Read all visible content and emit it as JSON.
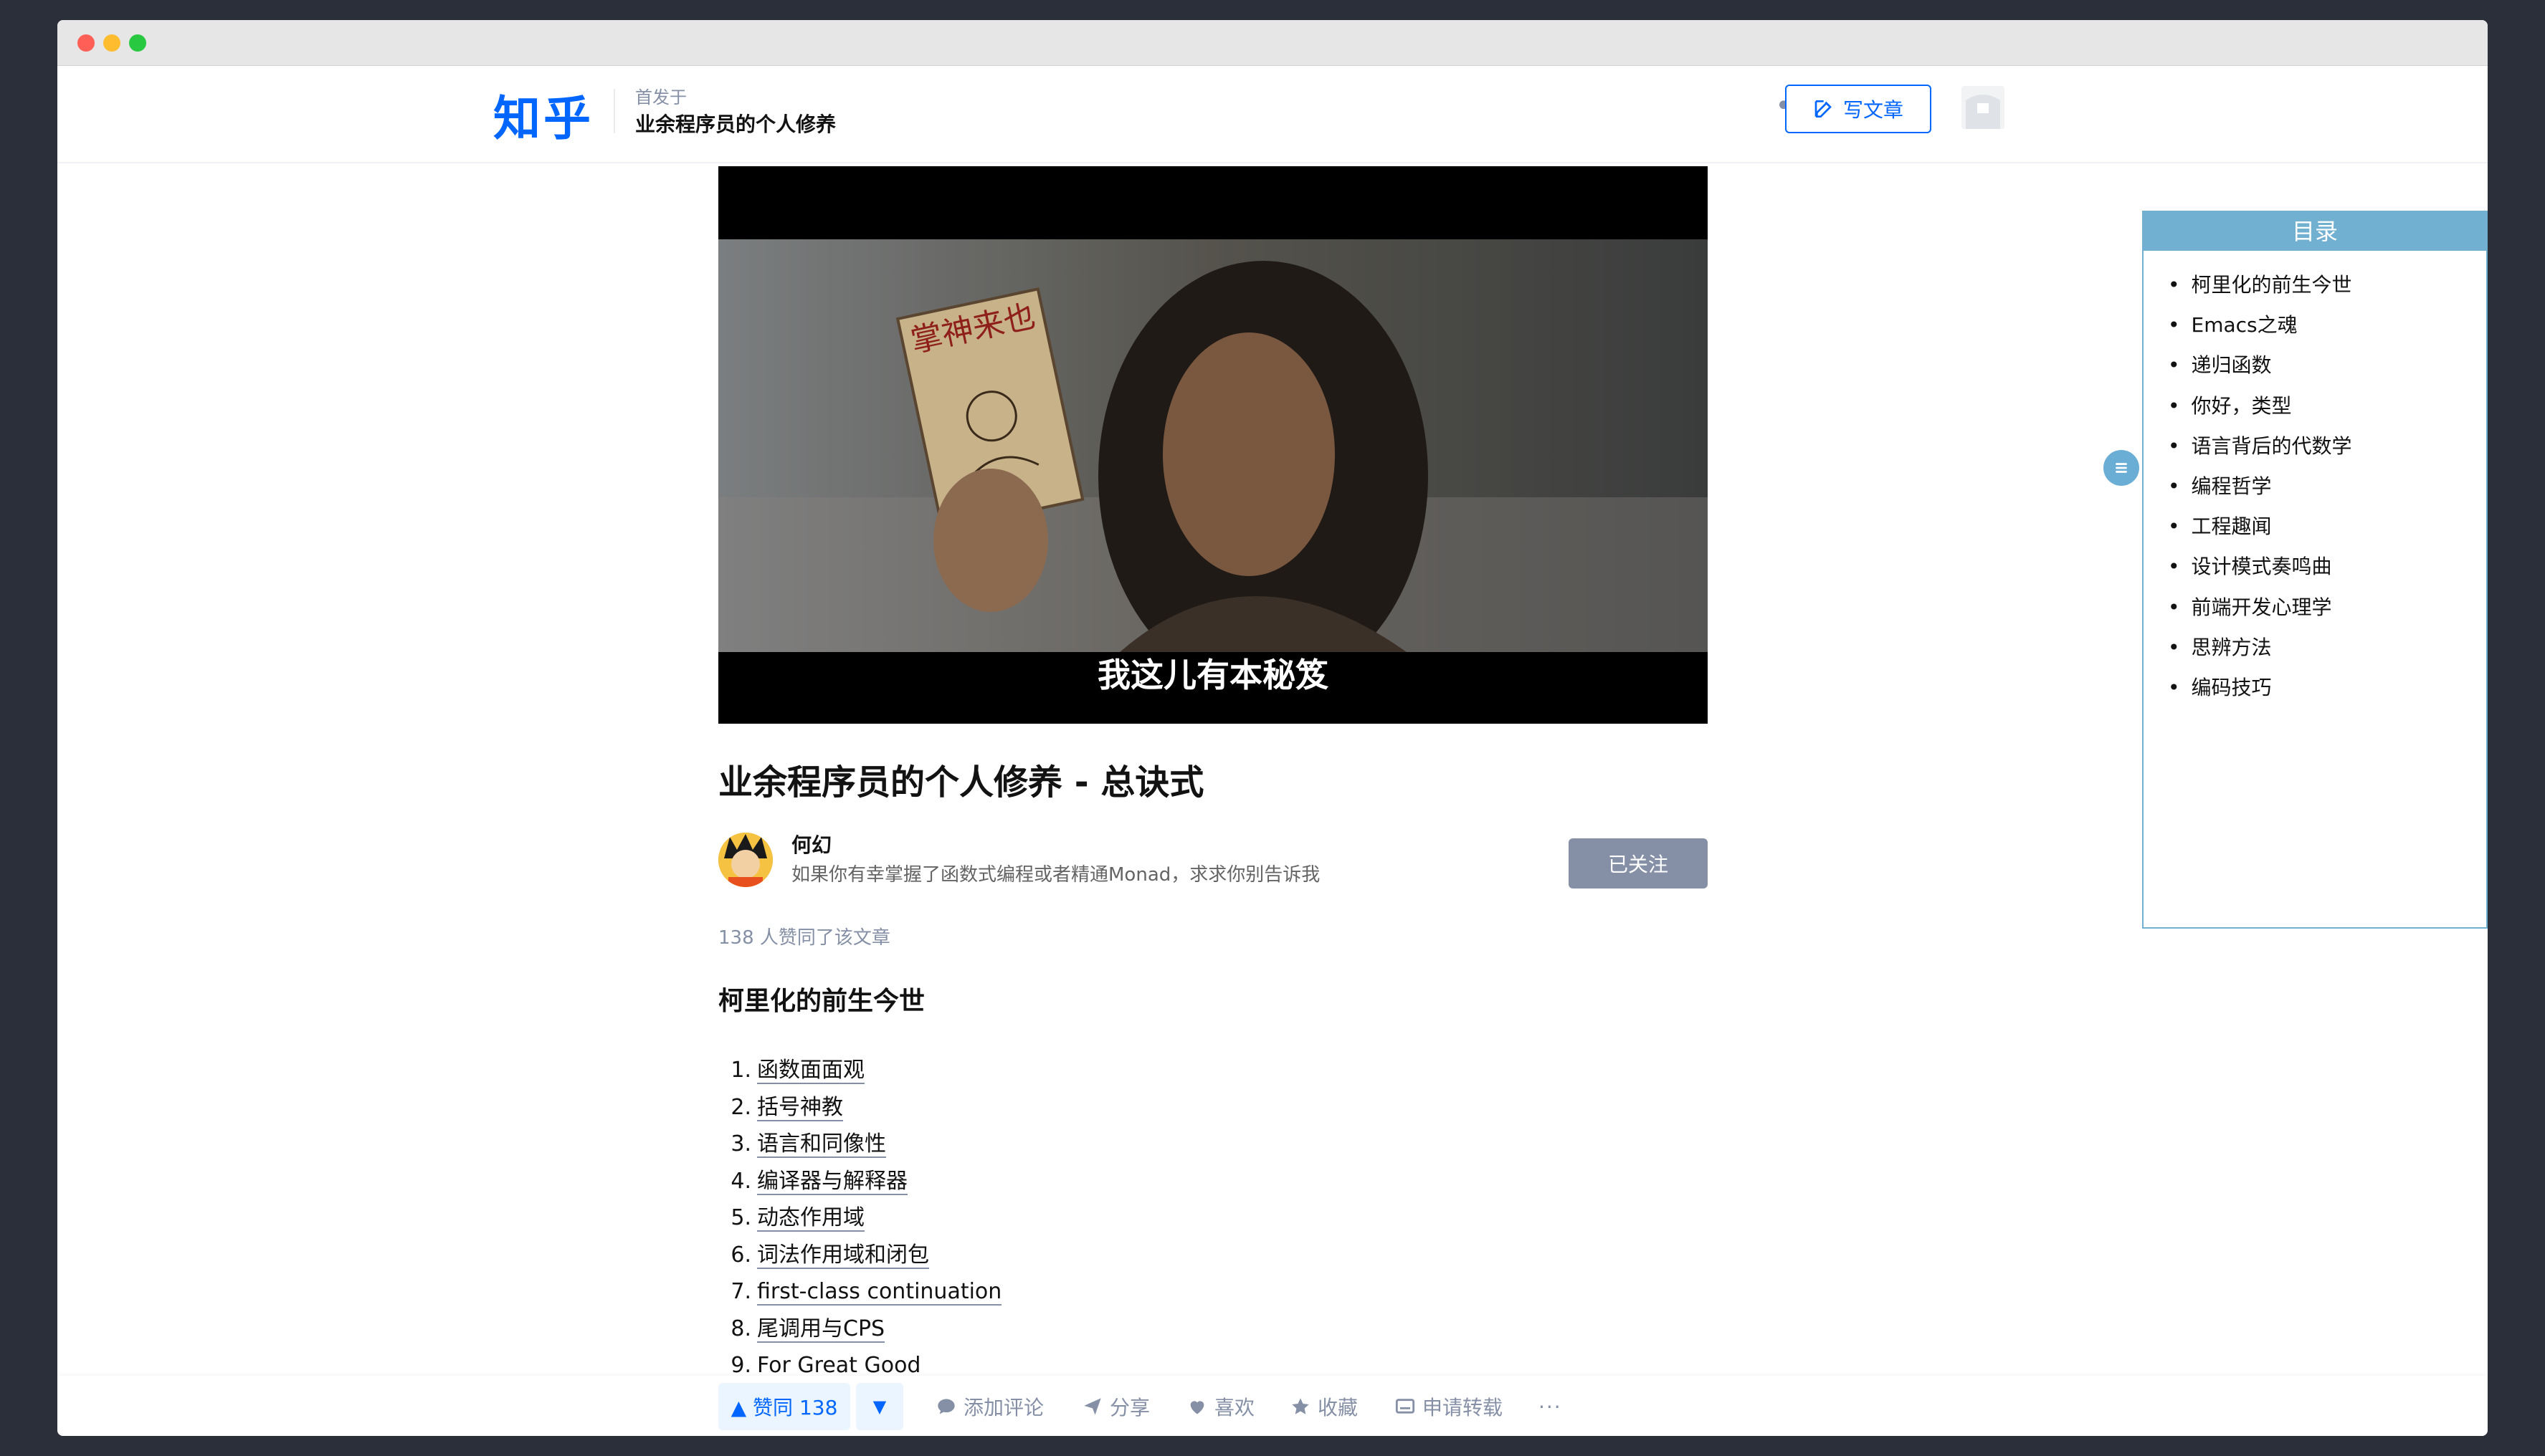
{
  "header": {
    "logo": "知乎",
    "first_published": "首发于",
    "column_name": "业余程序员的个人修养",
    "more_label": "•••",
    "write_label": "写文章"
  },
  "hero": {
    "subtitle": "我这儿有本秘笈",
    "book_title": "掌神来也"
  },
  "article": {
    "title": "业余程序员的个人修养 - 总诀式",
    "author_name": "何幻",
    "author_bio": "如果你有幸掌握了函数式编程或者精通Monad，求求你别告诉我",
    "follow_label": "已关注",
    "vote_text": "138 人赞同了该文章",
    "section_heading": "柯里化的前生今世",
    "items": [
      {
        "num": "1.",
        "text": "函数面面观"
      },
      {
        "num": "2.",
        "text": "括号神教"
      },
      {
        "num": "3.",
        "text": "语言和同像性"
      },
      {
        "num": "4.",
        "text": "编译器与解释器"
      },
      {
        "num": "5.",
        "text": "动态作用域"
      },
      {
        "num": "6.",
        "text": "词法作用域和闭包"
      },
      {
        "num": "7.",
        "text": "first-class continuation"
      },
      {
        "num": "8.",
        "text": "尾调用与CPS"
      },
      {
        "num": "9.",
        "text": "For Great Good"
      }
    ]
  },
  "actions": {
    "upvote": "▲ 赞同 138",
    "downvote": "▼",
    "comment": "添加评论",
    "share": "分享",
    "like": "喜欢",
    "collect": "收藏",
    "repost": "申请转载",
    "more": "···"
  },
  "toc": {
    "title": "目录",
    "items": [
      "柯里化的前生今世",
      "Emacs之魂",
      "递归函数",
      "你好，类型",
      "语言背后的代数学",
      "编程哲学",
      "工程趣闻",
      "设计模式奏鸣曲",
      "前端开发心理学",
      "思辨方法",
      "编码技巧"
    ]
  },
  "colors": {
    "brand": "#0066ff",
    "toc_accent": "#72b0d1",
    "muted": "#8590a6"
  }
}
